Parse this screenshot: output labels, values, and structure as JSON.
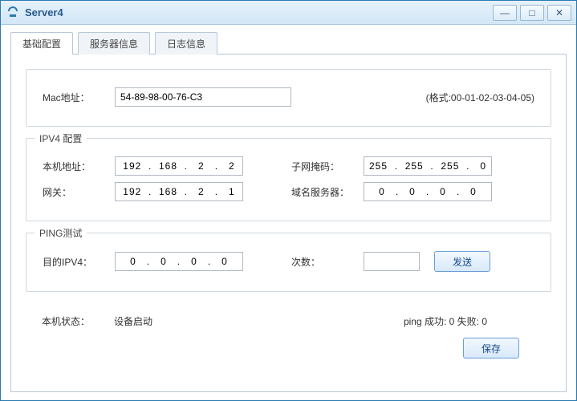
{
  "window": {
    "title": "Server4"
  },
  "tabs": {
    "basic": "基础配置",
    "serverInfo": "服务器信息",
    "logInfo": "日志信息"
  },
  "mac": {
    "label": "Mac地址：",
    "value": "54-89-98-00-76-C3",
    "formatHint": "(格式:00-01-02-03-04-05)"
  },
  "ipv4Section": {
    "legend": "IPV4 配置",
    "localAddrLabel": "本机地址：",
    "localAddrValue": "192  .  168  .   2   .   2",
    "subnetLabel": "子网掩码：",
    "subnetValue": "255  .  255  .  255  .   0",
    "gatewayLabel": "网关：",
    "gatewayValue": "192  .  168  .   2   .   1",
    "dnsLabel": "域名服务器：",
    "dnsValue": "0   .   0   .   0   .   0"
  },
  "pingSection": {
    "legend": "PING测试",
    "targetLabel": "目的IPV4：",
    "targetValue": "0   .   0   .   0   .   0",
    "countLabel": "次数：",
    "countValue": "",
    "sendLabel": "发送"
  },
  "status": {
    "machineStateLabel": "本机状态：",
    "machineStateValue": "设备启动",
    "pingResult": "ping 成功: 0 失败: 0"
  },
  "actions": {
    "saveLabel": "保存"
  }
}
